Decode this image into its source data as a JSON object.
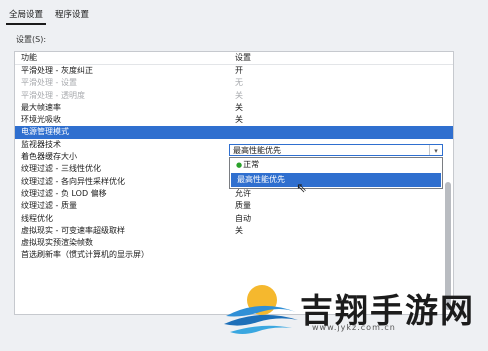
{
  "tabs": [
    {
      "label": "全局设置",
      "active": true
    },
    {
      "label": "程序设置",
      "active": false
    }
  ],
  "settings_label": "设置(S):",
  "table": {
    "columns": [
      "功能",
      "设置"
    ],
    "rows": [
      {
        "feature": "平滑处理 - 灰度纠正",
        "value": "开",
        "state": "normal"
      },
      {
        "feature": "平滑处理 - 设置",
        "value": "无",
        "state": "disabled"
      },
      {
        "feature": "平滑处理 - 透明度",
        "value": "关",
        "state": "disabled"
      },
      {
        "feature": "最大帧速率",
        "value": "关",
        "state": "normal"
      },
      {
        "feature": "环境光吸收",
        "value": "关",
        "state": "normal"
      },
      {
        "feature": "电源管理模式",
        "value": "最高性能优先",
        "state": "selected"
      },
      {
        "feature": "监视器技术",
        "value": "",
        "state": "normal"
      },
      {
        "feature": "着色器缓存大小",
        "value": "",
        "state": "normal"
      },
      {
        "feature": "纹理过滤 - 三线性优化",
        "value": "开",
        "state": "normal"
      },
      {
        "feature": "纹理过滤 - 各向异性采样优化",
        "value": "开",
        "state": "normal"
      },
      {
        "feature": "纹理过滤 - 负 LOD 偏移",
        "value": "允许",
        "state": "normal"
      },
      {
        "feature": "纹理过滤 - 质量",
        "value": "质量",
        "state": "normal"
      },
      {
        "feature": "线程优化",
        "value": "自动",
        "state": "normal"
      },
      {
        "feature": "虚拟现实 - 可变速率超级取样",
        "value": "关",
        "state": "normal"
      },
      {
        "feature": "虚拟现实预渲染帧数",
        "value": "",
        "state": "normal"
      },
      {
        "feature": "首选刷新率（惯式计算机的显示屏）",
        "value": "",
        "state": "normal"
      }
    ]
  },
  "combo": {
    "value": "最高性能优先",
    "arrow_icon": "chevron-down-icon"
  },
  "dropdown": {
    "options": [
      {
        "label": "正常",
        "icon": "nvidia-logo-icon",
        "highlighted": false
      },
      {
        "label": "最高性能优先",
        "icon": "",
        "highlighted": true
      }
    ]
  },
  "watermark": {
    "text": "吉翔手游网",
    "url": "www.jykz.com.cn"
  },
  "colors": {
    "selection": "#2f6fcf",
    "background": "#eef0f3"
  }
}
